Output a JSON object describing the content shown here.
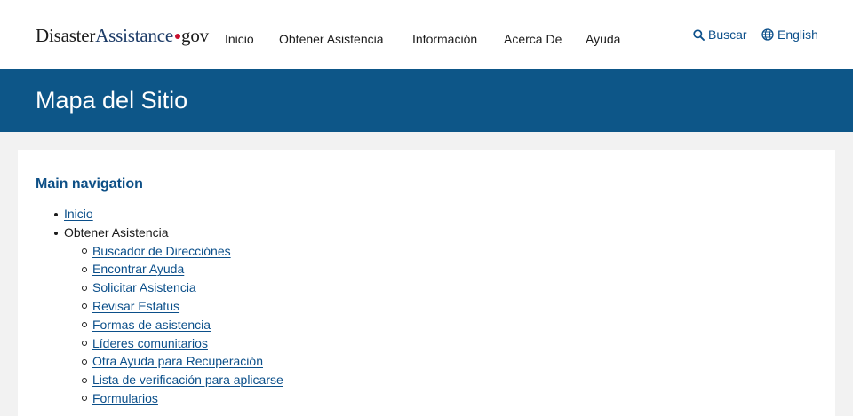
{
  "logo": {
    "part1": "Disaster",
    "part2": "Assistance",
    "part3": "gov",
    "dot_color": "#c8102e"
  },
  "nav": {
    "items": [
      "Inicio",
      "Obtener Asistencia",
      "Información",
      "Acerca De",
      "Ayuda"
    ]
  },
  "utility": {
    "search_label": "Buscar",
    "search_icon": "search-icon",
    "language_label": "English",
    "language_icon": "globe-icon"
  },
  "banner": {
    "title": "Mapa del Sitio",
    "background": "#0d5688"
  },
  "sitemap": {
    "heading": "Main navigation",
    "items": [
      {
        "label": "Inicio"
      },
      {
        "label": "Obtener Asistencia",
        "children": [
          "Buscador de Direcciónes",
          "Encontrar Ayuda",
          "Solicitar Asistencia",
          "Revisar Estatus",
          "Formas de asistencia",
          "Líderes comunitarios",
          "Otra Ayuda para Recuperación",
          "Lista de verificación para aplicarse",
          "Formularios"
        ]
      }
    ]
  },
  "colors": {
    "link": "#0b4f8a",
    "heading": "#0d4f86",
    "page_background": "#f2f2f2"
  }
}
